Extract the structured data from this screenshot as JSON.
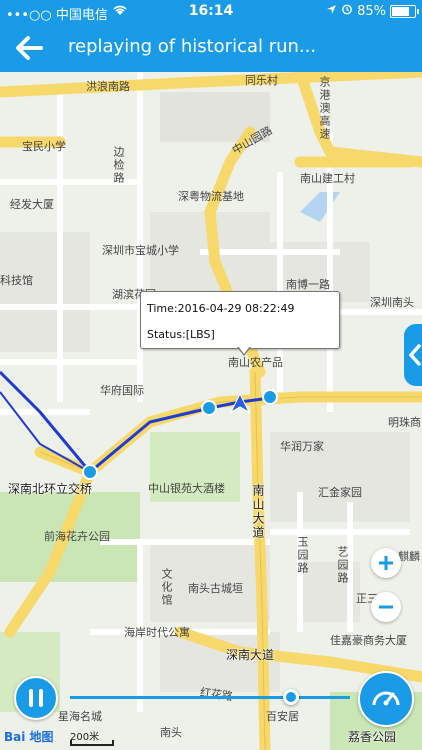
{
  "status_bar": {
    "carrier": "•••○○ 中国电信",
    "time": "16:14",
    "battery": "85%"
  },
  "nav": {
    "title": "replaying of historical run..."
  },
  "popup": {
    "time_line": "Time:2016-04-29 08:22:49",
    "status_line": "Status:[LBS]"
  },
  "map_labels": {
    "hongnan": "洪浪南路",
    "tongle": "同乐村",
    "gangaou": "京港澳高速",
    "zhongshanyuan": "中山园路",
    "baomin": "宝民小学",
    "bianjian": "边检路",
    "nanshanjian": "南山建工村",
    "shenyue": "深粤物流基地",
    "jingfa": "经发大厦",
    "baocheng": "深圳市宝城小学",
    "technology": "科技馆",
    "hubin": "湖滨花园",
    "nanbo": "南博一路",
    "shenzhennan": "深圳南头",
    "nanshannongchan": "南山农产品",
    "huafu": "华府国际",
    "mingzhu": "明珠商",
    "huarun": "华润万家",
    "shennanbei": "深南北环立交桥",
    "zhongshanyin": "中山银苑大酒楼",
    "huijin": "汇金家园",
    "nanshandao": "南山大道",
    "qianhai": "前海花卉公园",
    "yuyuan": "玉园路",
    "yiyuan": "艺园路",
    "qilin": "麒麟",
    "wenhua": "文化馆",
    "nantou_old": "南头古城垣",
    "zhengsan": "正三",
    "haianzhi": "海岸时代公寓",
    "jiahao": "佳嘉豪商务大厦",
    "shennandao": "深南大道",
    "xingzhi": "星海名城",
    "honghua": "红花路",
    "baian": "百安居",
    "nantou": "南头",
    "lizhi": "荔香公园",
    "lixiang": "荔香"
  },
  "controls": {
    "playback_progress": 0.79
  },
  "map_footer": {
    "brand": "Bai 地图",
    "scale": "200米"
  },
  "colors": {
    "primary": "#1a9be8",
    "route": "#1f3bd6",
    "road_major": "#f7d86a",
    "road_minor": "#ffffff",
    "green": "#c9e6b4"
  },
  "icons": {
    "back": "back-arrow-icon",
    "location_arrow": "location-arrow-icon",
    "alarm": "alarm-icon",
    "wifi": "wifi-icon",
    "pause": "pause-icon",
    "speed": "speedometer-icon",
    "zoom_in": "plus-icon",
    "zoom_out": "minus-icon",
    "side_panel": "chevron-left-icon"
  }
}
